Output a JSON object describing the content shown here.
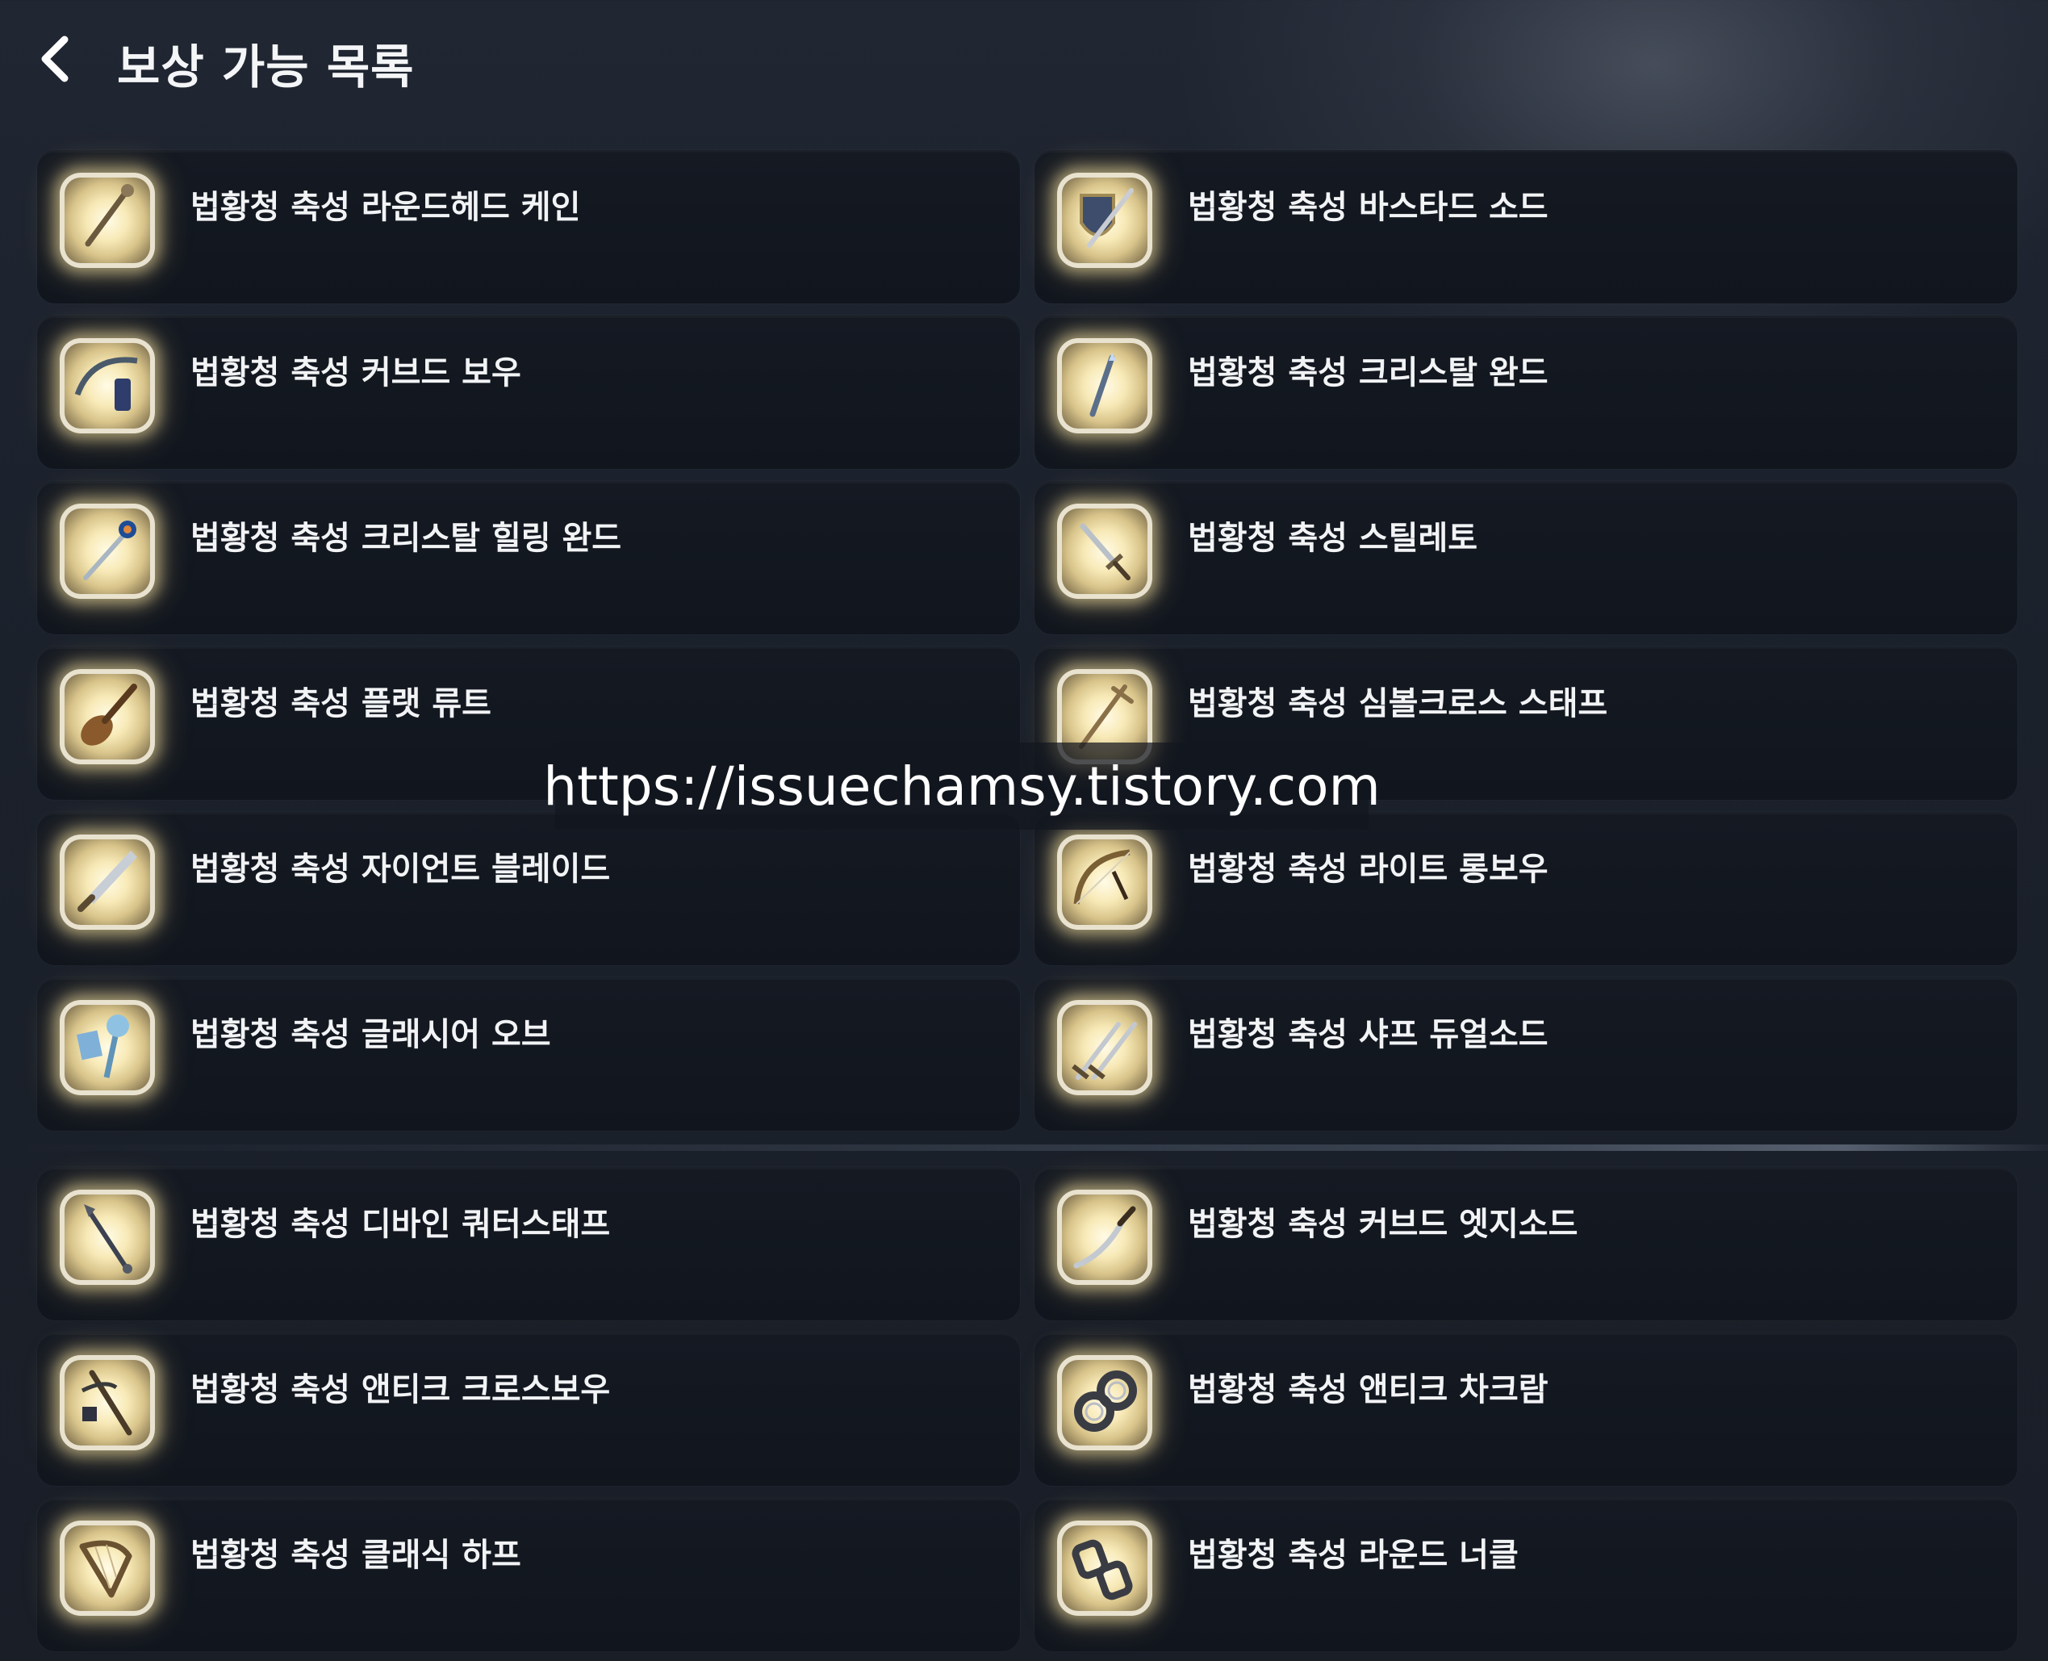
{
  "header": {
    "title": "보상 가능 목록",
    "back_icon": "chevron-left-icon"
  },
  "items": [
    {
      "name": "법황청 축성 라운드헤드 케인",
      "icon": "cane-icon"
    },
    {
      "name": "법황청 축성 바스타드 소드",
      "icon": "shield-sword-icon"
    },
    {
      "name": "법황청 축성 커브드 보우",
      "icon": "bow-icon"
    },
    {
      "name": "법황청 축성 크리스탈 완드",
      "icon": "wand-icon"
    },
    {
      "name": "법황청 축성 크리스탈 힐링 완드",
      "icon": "healing-wand-icon"
    },
    {
      "name": "법황청 축성 스틸레토",
      "icon": "dagger-icon"
    },
    {
      "name": "법황청 축성 플랫 류트",
      "icon": "lute-icon"
    },
    {
      "name": "법황청 축성 심볼크로스 스태프",
      "icon": "cross-staff-icon"
    },
    {
      "name": "법황청 축성 자이언트 블레이드",
      "icon": "greatsword-icon"
    },
    {
      "name": "법황청 축성 라이트 롱보우",
      "icon": "longbow-icon"
    },
    {
      "name": "법황청 축성 글래시어 오브",
      "icon": "orb-icon"
    },
    {
      "name": "법황청 축성 샤프 듀얼소드",
      "icon": "dual-swords-icon"
    },
    {
      "name": "법황청 축성 디바인 쿼터스태프",
      "icon": "quarterstaff-icon"
    },
    {
      "name": "법황청 축성 커브드 엣지소드",
      "icon": "curved-sword-icon"
    },
    {
      "name": "법황청 축성 앤티크 크로스보우",
      "icon": "crossbow-icon"
    },
    {
      "name": "법황청 축성 앤티크 차크람",
      "icon": "chakram-icon"
    },
    {
      "name": "법황청 축성 클래식 하프",
      "icon": "harp-icon"
    },
    {
      "name": "법황청 축성 라운드 너클",
      "icon": "knuckle-icon"
    }
  ],
  "watermark": "https://issuechamsy.tistory.com",
  "colors": {
    "background": "#1b212b",
    "card": "#141922",
    "text": "#f2f3f5",
    "icon_glow": "#f8eab8"
  }
}
